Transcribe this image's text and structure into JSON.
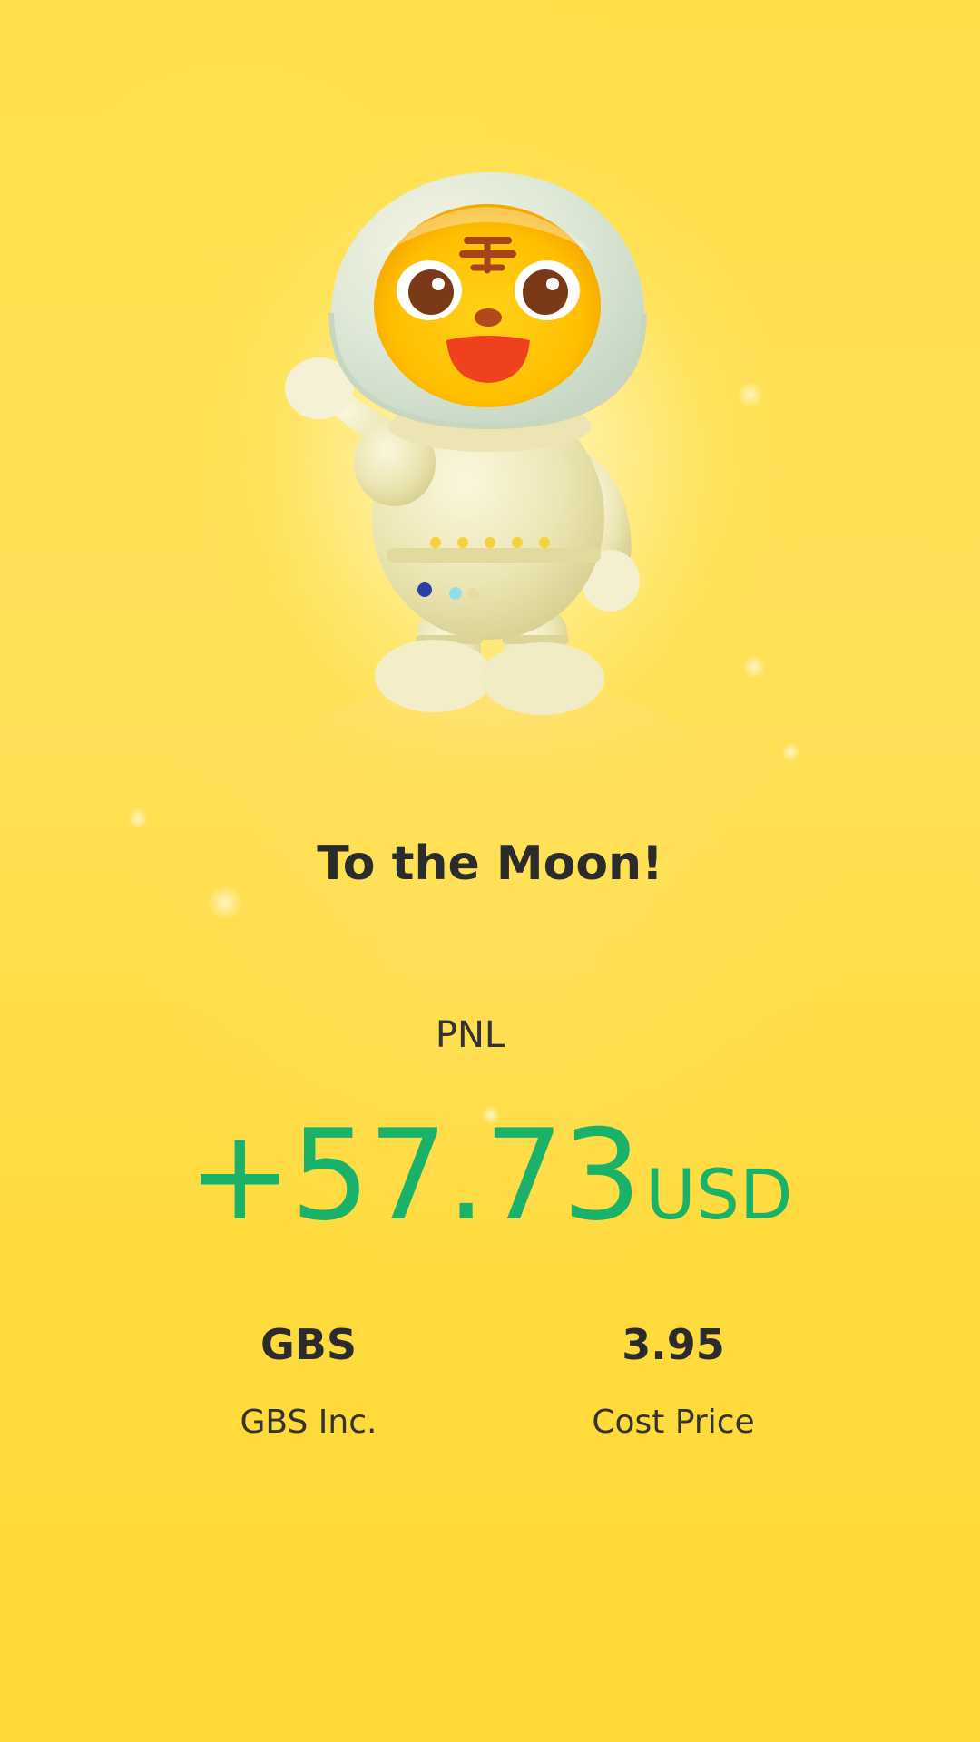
{
  "title": "To the Moon!",
  "pnl": {
    "label": "PNL",
    "value": "+57.73",
    "unit": "USD",
    "color": "#19b268"
  },
  "stock": {
    "symbol": "GBS",
    "name": "GBS Inc."
  },
  "cost": {
    "value": "3.95",
    "label": "Cost Price"
  },
  "colors": {
    "background": "#ffd83a",
    "text": "#2b2b2b"
  },
  "mascot": {
    "icon": "tiger-astronaut-mascot"
  }
}
